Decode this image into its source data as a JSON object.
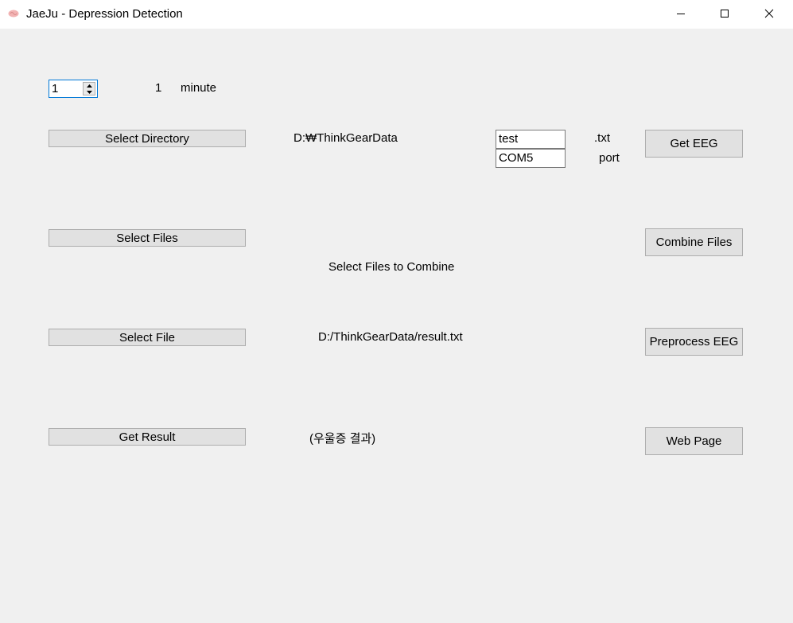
{
  "window": {
    "title": "JaeJu - Depression Detection",
    "app_icon": "brain-icon",
    "controls": {
      "minimize": "minimize-icon",
      "maximize": "maximize-icon",
      "close": "close-icon"
    }
  },
  "duration": {
    "spinner_value": "1",
    "display_value": "1",
    "unit_label": "minute"
  },
  "row_directory": {
    "button_label": "Select Directory",
    "path": "D:₩ThinkGearData",
    "filename_input": "test",
    "filename_ext": ".txt",
    "port_input": "COM5",
    "port_label": "port",
    "action_label": "Get EEG"
  },
  "row_files": {
    "button_label": "Select Files",
    "status": "Select Files to Combine",
    "action_label": "Combine Files"
  },
  "row_file": {
    "button_label": "Select File",
    "path": "D:/ThinkGearData/result.txt",
    "action_label": "Preprocess EEG"
  },
  "row_result": {
    "button_label": "Get Result",
    "result": "(우울증 결과)",
    "action_label": "Web Page"
  }
}
